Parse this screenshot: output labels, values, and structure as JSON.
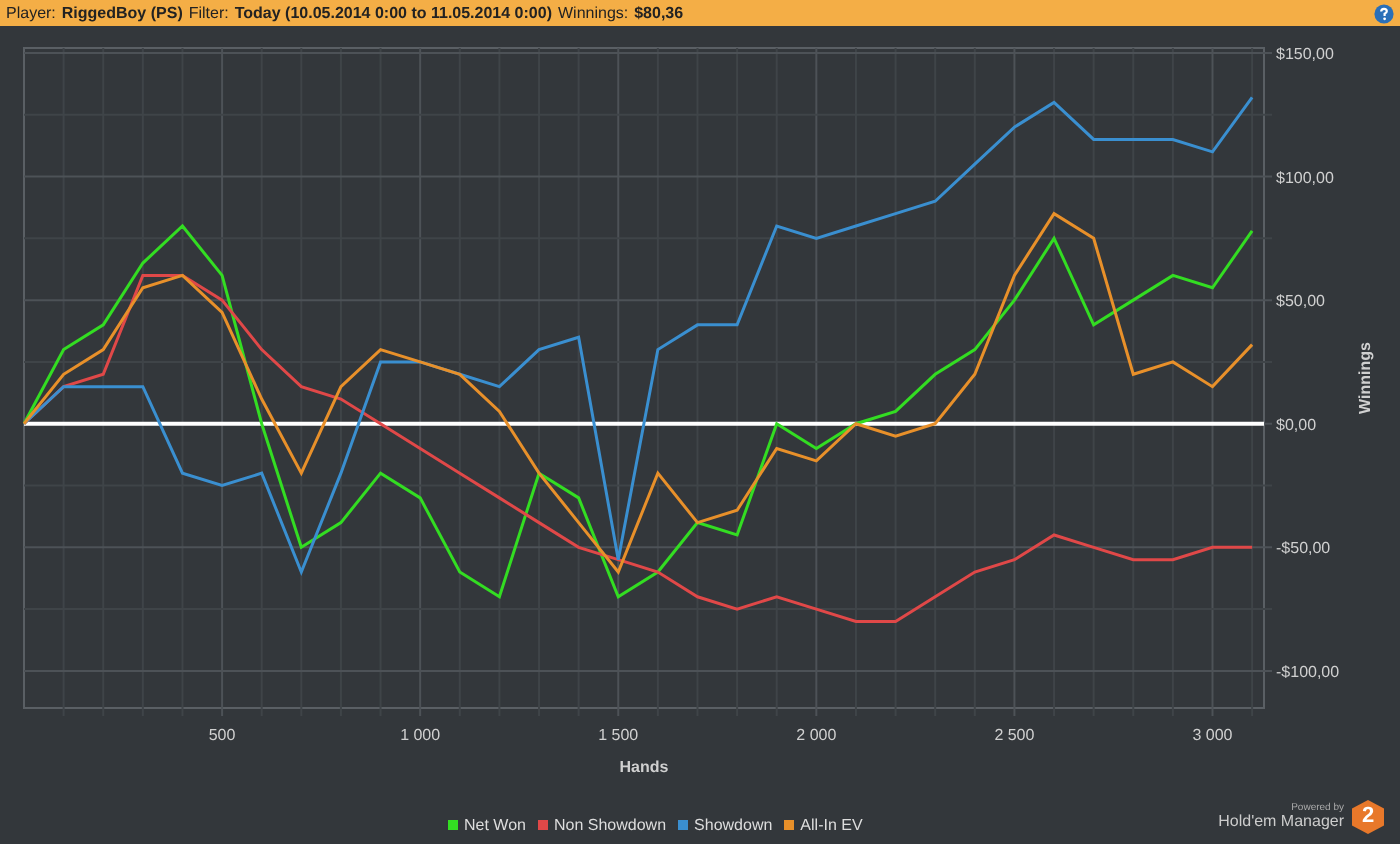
{
  "header": {
    "player_label": "Player:",
    "player": "RiggedBoy (PS)",
    "filter_label": "Filter:",
    "filter": "Today (10.05.2014 0:00 to 11.05.2014 0:00)",
    "winnings_label": "Winnings:",
    "winnings": "$80,36"
  },
  "chart": {
    "chart_data": {
      "type": "line",
      "xlabel": "Hands",
      "ylabel": "Winnings",
      "x": [
        0,
        100,
        200,
        300,
        400,
        500,
        600,
        700,
        800,
        900,
        1000,
        1100,
        1200,
        1300,
        1400,
        1500,
        1600,
        1700,
        1800,
        1900,
        2000,
        2100,
        2200,
        2300,
        2400,
        2500,
        2600,
        2700,
        2800,
        2900,
        3000,
        3100
      ],
      "series": [
        {
          "name": "Net Won",
          "color": "#33dd22",
          "values": [
            0,
            30,
            40,
            65,
            80,
            60,
            0,
            -50,
            -40,
            -20,
            -30,
            -60,
            -70,
            -20,
            -30,
            -70,
            -60,
            -40,
            -45,
            0,
            -10,
            0,
            5,
            20,
            30,
            50,
            75,
            40,
            50,
            60,
            55,
            78
          ]
        },
        {
          "name": "Non Showdown",
          "color": "#e04848",
          "values": [
            0,
            15,
            20,
            60,
            60,
            50,
            30,
            15,
            10,
            0,
            -10,
            -20,
            -30,
            -40,
            -50,
            -55,
            -60,
            -70,
            -75,
            -70,
            -75,
            -80,
            -80,
            -70,
            -60,
            -55,
            -45,
            -50,
            -55,
            -55,
            -50,
            -50
          ]
        },
        {
          "name": "Showdown",
          "color": "#3a8fd0",
          "values": [
            0,
            15,
            15,
            15,
            -20,
            -25,
            -20,
            -60,
            -20,
            25,
            25,
            20,
            15,
            30,
            35,
            -55,
            30,
            40,
            40,
            80,
            75,
            80,
            85,
            90,
            105,
            120,
            130,
            115,
            115,
            115,
            110,
            132
          ]
        },
        {
          "name": "All-In EV",
          "color": "#e8902a",
          "values": [
            0,
            20,
            30,
            55,
            60,
            45,
            10,
            -20,
            15,
            30,
            25,
            20,
            5,
            -20,
            -40,
            -60,
            -20,
            -40,
            -35,
            -10,
            -15,
            0,
            -5,
            0,
            20,
            60,
            85,
            75,
            20,
            25,
            15,
            32
          ]
        }
      ],
      "grid": true,
      "xlim": [
        0,
        3130
      ],
      "ylim": [
        -115,
        152
      ],
      "xticks": [
        {
          "value": 500,
          "label": "500"
        },
        {
          "value": 1000,
          "label": "1 000"
        },
        {
          "value": 1500,
          "label": "1 500"
        },
        {
          "value": 2000,
          "label": "2 000"
        },
        {
          "value": 2500,
          "label": "2 500"
        },
        {
          "value": 3000,
          "label": "3 000"
        }
      ],
      "yticks": [
        {
          "value": -100,
          "label": "-$100,00"
        },
        {
          "value": -50,
          "label": "-$50,00"
        },
        {
          "value": 0,
          "label": "$0,00"
        },
        {
          "value": 50,
          "label": "$50,00"
        },
        {
          "value": 100,
          "label": "$100,00"
        },
        {
          "value": 150,
          "label": "$150,00"
        }
      ]
    }
  },
  "branding": {
    "powered_by": "Powered by",
    "product": "Hold'em Manager",
    "mark": "2"
  }
}
